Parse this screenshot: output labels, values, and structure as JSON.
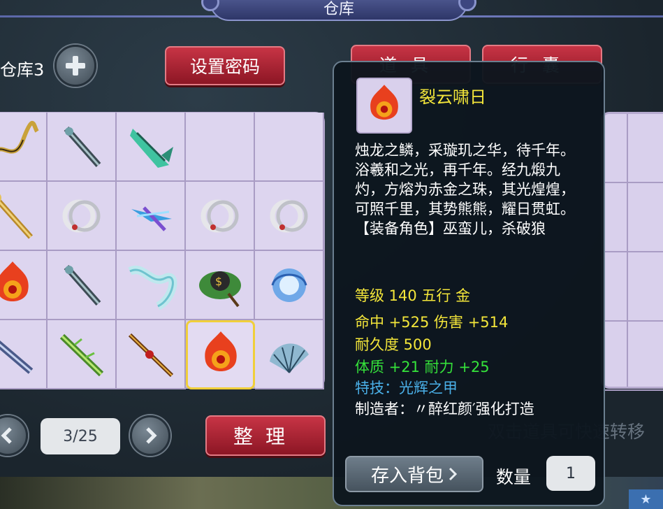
{
  "window": {
    "title": "仓库"
  },
  "warehouse": {
    "label": "仓库3"
  },
  "buttons": {
    "set_password": "设置密码",
    "tab_items": "道具",
    "tab_bag": "行囊",
    "sort": "整理"
  },
  "pager": {
    "page": "3/25"
  },
  "hint": "双击道具可快速转移",
  "grid": {
    "rows": [
      [
        "chain-whip-icon",
        "dark-sword-icon",
        "green-claw-blade-icon",
        "",
        ""
      ],
      [
        "golden-staff-icon",
        "silver-ring-icon",
        "blue-feather-blade-icon",
        "silver-ring-icon",
        "silver-ring-icon"
      ],
      [
        "fire-gem-icon",
        "dark-sword-icon",
        "jade-ribbon-icon",
        "coin-wheel-icon",
        "blue-vortex-orb-icon"
      ],
      [
        "crystal-spear-icon",
        "vine-sword-icon",
        "red-spear-icon",
        "fire-gem-icon",
        "iron-fan-icon"
      ]
    ],
    "selected": {
      "row": 3,
      "col": 3
    }
  },
  "tooltip": {
    "icon": "fire-gem-icon",
    "name": "裂云啸日",
    "description": "烛龙之鳞，采璇玑之华，待千年。浴羲和之光，再千年。经九煅九灼，方熔为赤金之珠，其光煌煌，可照千里，其势熊熊，耀日贯虹。【装备角色】巫蛮儿，杀破狼",
    "level_line": "等级 140  五行 金",
    "attack_line": "命中 +525 伤害 +514",
    "durability_line": "耐久度 500",
    "stats_line": "体质 +21 耐力 +25",
    "skill_line": "特技：光辉之甲",
    "maker_line": "制造者：〃醉红颜′强化打造",
    "to_bag_button": "存入背包",
    "quantity_label": "数量",
    "quantity_value": "1"
  },
  "colors": {
    "accent_red": "#c73445",
    "tooltip_bg": "#0c161e",
    "name_yellow": "#f4e63a",
    "stat_green": "#35e23a",
    "skill_blue": "#4ab0e8",
    "slot_bg": "#ddd5ef",
    "selected_border": "#f0cf3a"
  }
}
